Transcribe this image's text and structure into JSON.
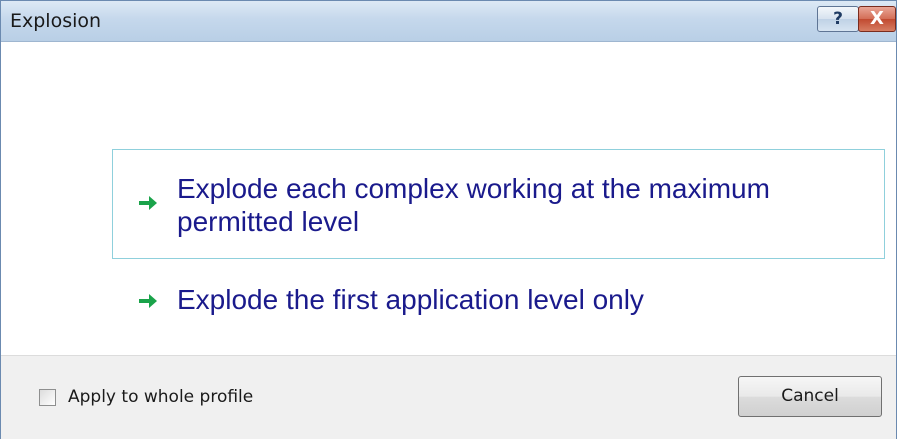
{
  "window": {
    "title": "Explosion",
    "help_label": "?",
    "close_label": "X"
  },
  "options": [
    {
      "label": "Explode each complex working at the maximum permitted level",
      "icon": "green-arrow-right-icon"
    },
    {
      "label": "Explode the first application level only",
      "icon": "green-arrow-right-icon"
    }
  ],
  "footer": {
    "checkbox_label": "Apply to whole profile",
    "checkbox_checked": false,
    "cancel_label": "Cancel"
  },
  "colors": {
    "option_text": "#1a1a8c",
    "arrow": "#1aa34a",
    "selected_border": "#8fd0dc"
  }
}
